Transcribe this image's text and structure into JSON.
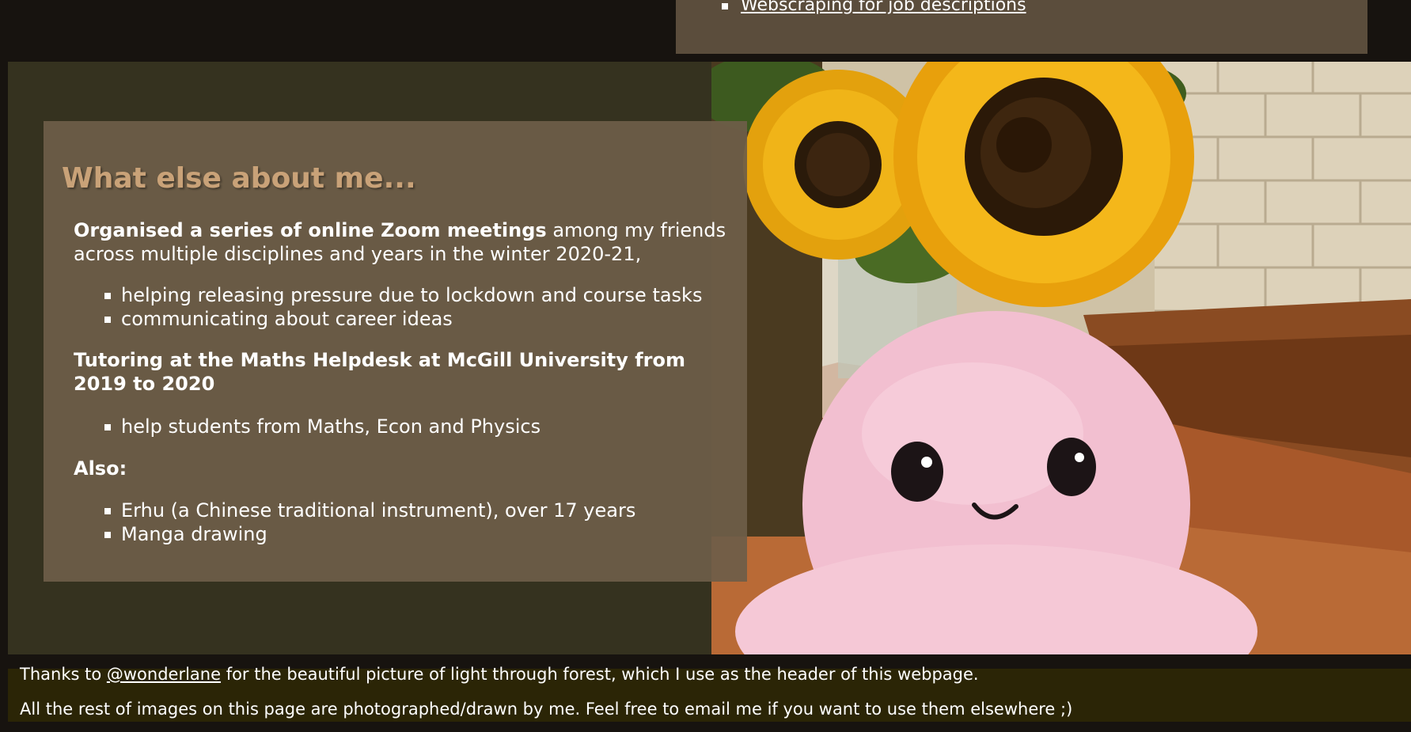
{
  "top_card": {
    "items": [
      {
        "label": "Webscraping for job descriptions"
      }
    ]
  },
  "about": {
    "heading": "What else about me...",
    "zoom": {
      "bold": "Organised a series of online Zoom meetings",
      "rest": " among my friends across multiple disciplines and years in the winter 2020-21,",
      "bullets": [
        "helping releasing pressure due to lockdown and course tasks",
        "communicating about career ideas"
      ]
    },
    "tutoring": {
      "bold": "Tutoring at the Maths Helpdesk at McGill University from 2019 to 2020",
      "bullets": [
        "help students from Maths, Econ and Physics"
      ]
    },
    "also": {
      "bold": "Also:",
      "bullets": [
        "Erhu (a Chinese traditional instrument), over 17 years",
        "Manga drawing"
      ]
    }
  },
  "footer": {
    "line1_prefix": "Thanks to ",
    "line1_link": "@wonderlane",
    "line1_suffix": " for the beautiful picture of light through forest, which I use as the header of this webpage.",
    "line2": "All the rest of images on this page are photographed/drawn by me. Feel free to email me if you want to use them elsewhere ;)"
  },
  "colors": {
    "page_bg": "#17130f",
    "section_bg": "#35321f",
    "panel_bg": "#6e5e48",
    "heading": "#c9a278",
    "footer_bg": "#2b2506"
  }
}
